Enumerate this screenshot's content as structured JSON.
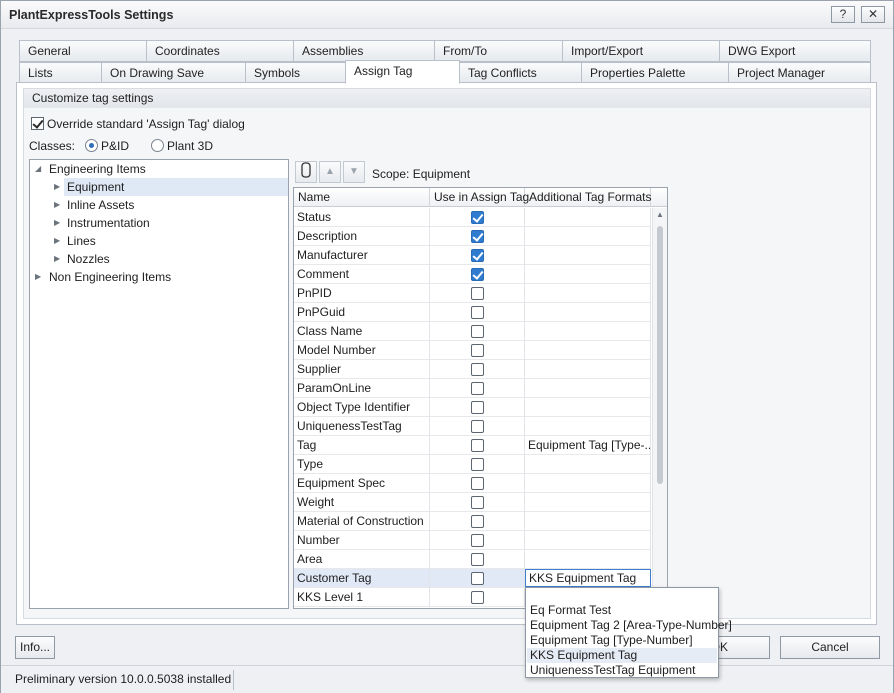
{
  "window": {
    "title": "PlantExpressTools Settings",
    "help_label": "?",
    "close_label": "✕"
  },
  "tabs_row1": [
    {
      "label": "General"
    },
    {
      "label": "Coordinates"
    },
    {
      "label": "Assemblies"
    },
    {
      "label": "From/To"
    },
    {
      "label": "Import/Export"
    },
    {
      "label": "DWG Export"
    }
  ],
  "tabs_row2": [
    {
      "label": "Lists"
    },
    {
      "label": "On Drawing Save"
    },
    {
      "label": "Symbols"
    },
    {
      "label": "Assign Tag",
      "active": true
    },
    {
      "label": "Tag Conflicts"
    },
    {
      "label": "Properties Palette"
    },
    {
      "label": "Project Manager"
    }
  ],
  "group": {
    "title": "Customize tag settings",
    "override_label": "Override standard 'Assign Tag' dialog",
    "override_checked": true,
    "classes_label": "Classes:",
    "class_options": [
      {
        "label": "P&ID",
        "selected": true
      },
      {
        "label": "Plant 3D",
        "selected": false
      }
    ]
  },
  "tree": {
    "nodes": [
      {
        "label": "Engineering Items",
        "expanded": true
      },
      {
        "label": "Equipment",
        "selected": true
      },
      {
        "label": "Inline Assets"
      },
      {
        "label": "Instrumentation"
      },
      {
        "label": "Lines"
      },
      {
        "label": "Nozzles"
      },
      {
        "label": "Non Engineering Items"
      }
    ]
  },
  "toolbar": {
    "up_symbol": "▲",
    "down_symbol": "▼",
    "scope_label": "Scope: Equipment"
  },
  "grid": {
    "columns": [
      "Name",
      "Use in Assign Tag",
      "Additional Tag Formats"
    ],
    "rows": [
      {
        "name": "Status",
        "use": true,
        "fmt": ""
      },
      {
        "name": "Description",
        "use": true,
        "fmt": ""
      },
      {
        "name": "Manufacturer",
        "use": true,
        "fmt": ""
      },
      {
        "name": "Comment",
        "use": true,
        "fmt": ""
      },
      {
        "name": "PnPID",
        "use": false,
        "fmt": ""
      },
      {
        "name": "PnPGuid",
        "use": false,
        "fmt": ""
      },
      {
        "name": "Class Name",
        "use": false,
        "fmt": ""
      },
      {
        "name": "Model Number",
        "use": false,
        "fmt": ""
      },
      {
        "name": "Supplier",
        "use": false,
        "fmt": ""
      },
      {
        "name": "ParamOnLine",
        "use": false,
        "fmt": ""
      },
      {
        "name": "Object Type Identifier",
        "use": false,
        "fmt": ""
      },
      {
        "name": "UniquenessTestTag",
        "use": false,
        "fmt": ""
      },
      {
        "name": "Tag",
        "use": false,
        "fmt": "Equipment Tag [Type-..."
      },
      {
        "name": "Type",
        "use": false,
        "fmt": ""
      },
      {
        "name": "Equipment Spec",
        "use": false,
        "fmt": ""
      },
      {
        "name": "Weight",
        "use": false,
        "fmt": ""
      },
      {
        "name": "Material of Construction",
        "use": false,
        "fmt": ""
      },
      {
        "name": "Number",
        "use": false,
        "fmt": ""
      },
      {
        "name": "Area",
        "use": false,
        "fmt": ""
      },
      {
        "name": "Customer Tag",
        "use": false,
        "fmt": "KKS Equipment Tag",
        "selected": true
      },
      {
        "name": "KKS Level 1",
        "use": false,
        "fmt": ""
      }
    ]
  },
  "dropdown": {
    "options": [
      {
        "label": ""
      },
      {
        "label": "Eq Format Test"
      },
      {
        "label": "Equipment Tag 2 [Area-Type-Number]"
      },
      {
        "label": "Equipment Tag [Type-Number]"
      },
      {
        "label": "KKS Equipment Tag",
        "highlighted": true
      },
      {
        "label": "UniquenessTestTag Equipment"
      }
    ]
  },
  "buttons": {
    "info": "Info...",
    "ok": "OK",
    "cancel": "Cancel"
  },
  "status": {
    "text": "Preliminary version 10.0.0.5038 installed"
  }
}
